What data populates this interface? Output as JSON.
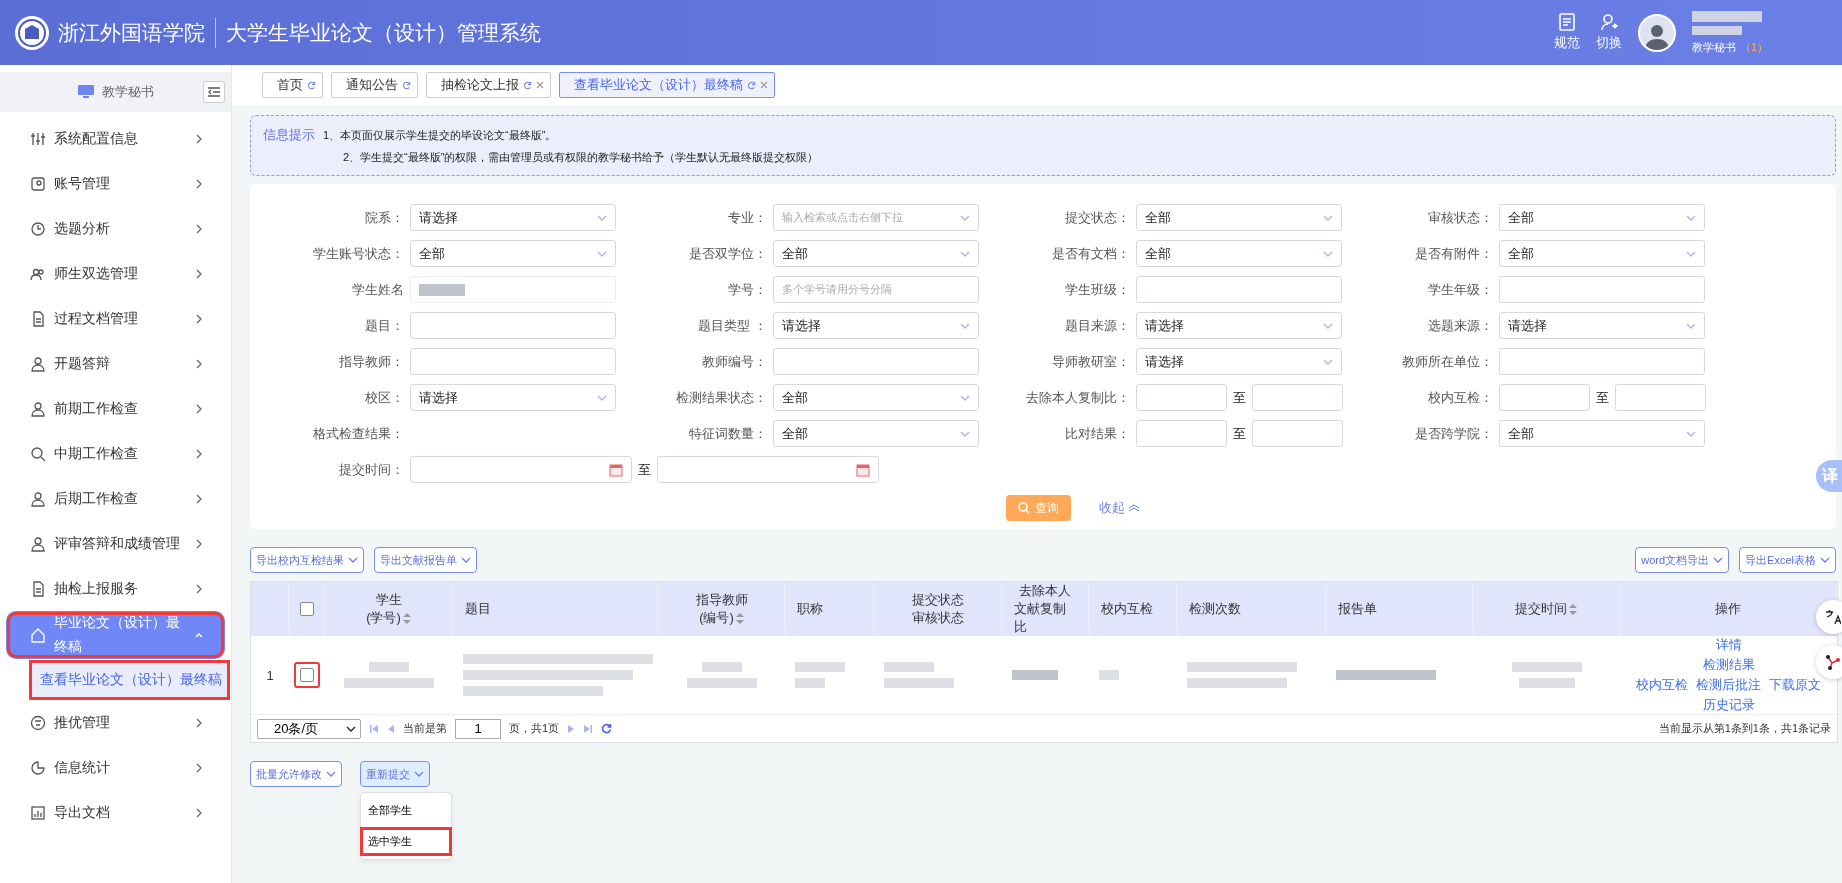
{
  "header": {
    "school": "浙江外国语学院",
    "system": "大学生毕业论文（设计）管理系统",
    "actions": [
      {
        "label": "规范",
        "kind": "doc"
      },
      {
        "label": "切换",
        "kind": "switch"
      }
    ],
    "role": "教学秘书",
    "count": "（1）"
  },
  "sidebar": {
    "title": "教学秘书",
    "items": [
      {
        "label": "系统配置信息",
        "expanded": false,
        "highlighted": false
      },
      {
        "label": "账号管理",
        "expanded": false,
        "highlighted": false
      },
      {
        "label": "选题分析",
        "expanded": false,
        "highlighted": false
      },
      {
        "label": "师生双选管理",
        "expanded": false,
        "highlighted": false
      },
      {
        "label": "过程文档管理",
        "expanded": false,
        "highlighted": false
      },
      {
        "label": "开题答辩",
        "expanded": false,
        "highlighted": false
      },
      {
        "label": "前期工作检查",
        "expanded": false,
        "highlighted": false
      },
      {
        "label": "中期工作检查",
        "expanded": false,
        "highlighted": false
      },
      {
        "label": "后期工作检查",
        "expanded": false,
        "highlighted": false
      },
      {
        "label": "评审答辩和成绩管理",
        "expanded": false,
        "highlighted": false
      },
      {
        "label": "抽检上报服务",
        "expanded": false,
        "highlighted": false
      },
      {
        "label": "毕业论文（设计）最终稿",
        "expanded": true,
        "highlighted": true,
        "children": [
          {
            "label": "查看毕业论文（设计）最终稿",
            "selected": true,
            "highlighted": true
          }
        ]
      },
      {
        "label": "推优管理",
        "expanded": false,
        "highlighted": false
      },
      {
        "label": "信息统计",
        "expanded": false,
        "highlighted": false
      },
      {
        "label": "导出文档",
        "expanded": false,
        "highlighted": false
      }
    ]
  },
  "tabs": [
    {
      "label": "首页",
      "selected": false,
      "closable": false
    },
    {
      "label": "通知公告",
      "selected": false,
      "closable": false
    },
    {
      "label": "抽检论文上报",
      "selected": false,
      "closable": true
    },
    {
      "label": "查看毕业论文（设计）最终稿",
      "selected": true,
      "closable": true
    }
  ],
  "notice": {
    "title": "信息提示",
    "lines": [
      "1、本页面仅展示学生提交的毕设论文“最终版”。",
      "2、学生提交“最终版”的权限，需由管理员或有权限的教学秘书给予（学生默认无最终版提交权限）"
    ]
  },
  "filters": [
    {
      "label": "院系：",
      "kind": "select",
      "value": "请选择"
    },
    {
      "label": "专业：",
      "kind": "select",
      "placeholder": "输入检索或点击右侧下拉"
    },
    {
      "label": "提交状态：",
      "kind": "select",
      "value": "全部"
    },
    {
      "label": "审核状态：",
      "kind": "select",
      "value": "全部"
    },
    {
      "label": "学生账号状态：",
      "kind": "select",
      "value": "全部"
    },
    {
      "label": "是否双学位：",
      "kind": "select",
      "value": "全部"
    },
    {
      "label": "是否有文档：",
      "kind": "select",
      "value": "全部"
    },
    {
      "label": "是否有附件：",
      "kind": "select",
      "value": "全部"
    },
    {
      "label": "学生姓名",
      "kind": "blurred"
    },
    {
      "label": "学号：",
      "kind": "text",
      "placeholder": "多个学号请用分号分隔"
    },
    {
      "label": "学生班级：",
      "kind": "text"
    },
    {
      "label": "学生年级：",
      "kind": "text"
    },
    {
      "label": "题目：",
      "kind": "text"
    },
    {
      "label": "题目类型 ：",
      "kind": "select",
      "value": "请选择"
    },
    {
      "label": "题目来源：",
      "kind": "select",
      "value": "请选择"
    },
    {
      "label": "选题来源：",
      "kind": "select",
      "value": "请选择"
    },
    {
      "label": "指导教师：",
      "kind": "text"
    },
    {
      "label": "教师编号：",
      "kind": "text"
    },
    {
      "label": "导师教研室：",
      "kind": "select",
      "value": "请选择"
    },
    {
      "label": "教师所在单位：",
      "kind": "text"
    },
    {
      "label": "校区：",
      "kind": "select",
      "value": "请选择"
    },
    {
      "label": "检测结果状态：",
      "kind": "select",
      "value": "全部"
    },
    {
      "label": "去除本人复制比：",
      "kind": "range",
      "to": "至"
    },
    {
      "label": "校内互检：",
      "kind": "range",
      "to": "至"
    },
    {
      "label": "格式检查结果：",
      "kind": "none"
    },
    {
      "label": "特征词数量：",
      "kind": "select",
      "value": "全部"
    },
    {
      "label": "比对结果：",
      "kind": "range",
      "to": "至"
    },
    {
      "label": "是否跨学院：",
      "kind": "select",
      "value": "全部"
    },
    {
      "label": "提交时间：",
      "kind": "date_range",
      "to": "至"
    }
  ],
  "query_button": "查询",
  "collapse_link": "收起",
  "export_left": [
    "导出校内互检结果",
    "导出文献报告单"
  ],
  "export_right": [
    "word文档导出",
    "导出Excel表格"
  ],
  "table": {
    "columns": [
      {
        "kind": "index"
      },
      {
        "kind": "check"
      },
      {
        "label": "学生",
        "sub": "(学号)",
        "sortable": true
      },
      {
        "label": "题目",
        "sortable": false
      },
      {
        "label": "指导教师",
        "sub": "(编号)",
        "sortable": true
      },
      {
        "label": "职称",
        "sortable": false
      },
      {
        "label": "提交状态",
        "sub": "审核状态",
        "sortable": false
      },
      {
        "label": "去除本人",
        "sub": "文献复制比",
        "sortable": false
      },
      {
        "label": "校内互检",
        "sortable": false
      },
      {
        "label": "检测次数",
        "sortable": false
      },
      {
        "label": "报告单",
        "sortable": false
      },
      {
        "label": "提交时间",
        "sortable": true
      },
      {
        "label": "操作",
        "sortable": false
      }
    ],
    "header_checked": false,
    "rows": [
      {
        "index": "1",
        "checked": false,
        "highlighted": true,
        "actions": [
          [
            "详情"
          ],
          [
            "检测结果"
          ],
          [
            "校内互检",
            "检测后批注",
            "下载原文"
          ],
          [
            "历史记录"
          ]
        ]
      }
    ]
  },
  "pager": {
    "page_size": "20条/页",
    "prefix": "当前是第",
    "page": "1",
    "suffix": "页，共1页",
    "summary": "当前显示从第1条到1条，共1条记录"
  },
  "bulk_buttons": [
    {
      "label": "批量允许修改",
      "open": false
    },
    {
      "label": "重新提交",
      "open": true
    }
  ],
  "dropdown": [
    {
      "label": "全部学生",
      "highlighted": false
    },
    {
      "label": "选中学生",
      "highlighted": true
    }
  ],
  "floating": {
    "translate": "译"
  }
}
